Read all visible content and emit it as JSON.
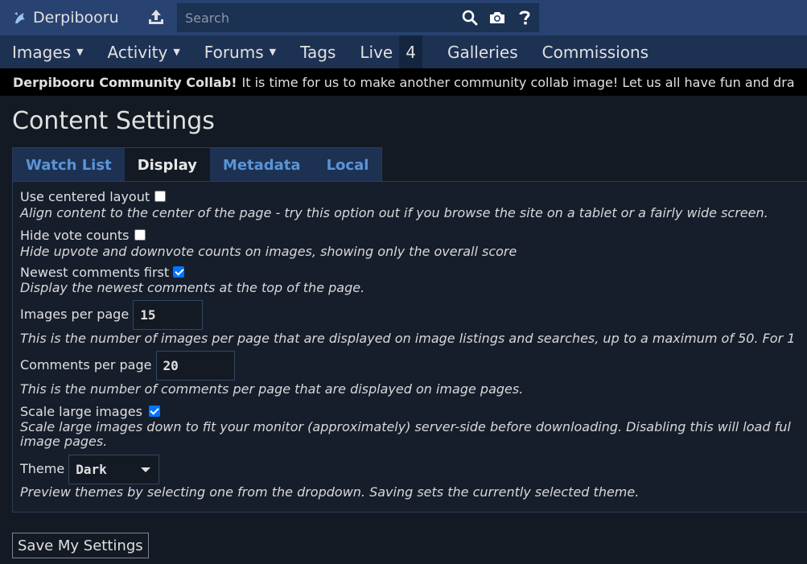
{
  "header": {
    "site_name": "Derpibooru",
    "search_placeholder": "Search"
  },
  "nav": {
    "items": [
      {
        "label": "Images",
        "dropdown": true
      },
      {
        "label": "Activity",
        "dropdown": true
      },
      {
        "label": "Forums",
        "dropdown": true
      },
      {
        "label": "Tags",
        "dropdown": false
      },
      {
        "label": "Live",
        "dropdown": false
      }
    ],
    "live_count": "4",
    "items_after": [
      {
        "label": "Galleries"
      },
      {
        "label": "Commissions"
      }
    ]
  },
  "notice": {
    "title": "Derpibooru Community Collab!",
    "text": "It is time for us to make another community collab image! Let us all have fun and dra"
  },
  "page": {
    "title": "Content Settings"
  },
  "tabs": [
    {
      "label": "Watch List",
      "active": false
    },
    {
      "label": "Display",
      "active": true
    },
    {
      "label": "Metadata",
      "active": false
    },
    {
      "label": "Local",
      "active": false
    }
  ],
  "settings": {
    "centered_layout": {
      "label": "Use centered layout",
      "checked": false,
      "description": "Align content to the center of the page - try this option out if you browse the site on a tablet or a fairly wide screen."
    },
    "hide_vote_counts": {
      "label": "Hide vote counts",
      "checked": false,
      "description": "Hide upvote and downvote counts on images, showing only the overall score"
    },
    "newest_comments_first": {
      "label": "Newest comments first",
      "checked": true,
      "description": "Display the newest comments at the top of the page."
    },
    "images_per_page": {
      "label": "Images per page",
      "value": "15",
      "description": "This is the number of images per page that are displayed on image listings and searches, up to a maximum of 50. For 1"
    },
    "comments_per_page": {
      "label": "Comments per page",
      "value": "20",
      "description": "This is the number of comments per page that are displayed on image pages."
    },
    "scale_large_images": {
      "label": "Scale large images",
      "checked": true,
      "description_line1": "Scale large images down to fit your monitor (approximately) server-side before downloading. Disabling this will load ful",
      "description_line2": "image pages."
    },
    "theme": {
      "label": "Theme",
      "selected": "Dark",
      "description": "Preview themes by selecting one from the dropdown. Saving sets the currently selected theme."
    }
  },
  "save_button": "Save My Settings",
  "colors": {
    "header_bg": "#284371",
    "nav_bg": "#1d3153",
    "page_bg": "#141a24",
    "link_blue": "#5a94d6",
    "checkbox_checked": "#0075ff"
  }
}
